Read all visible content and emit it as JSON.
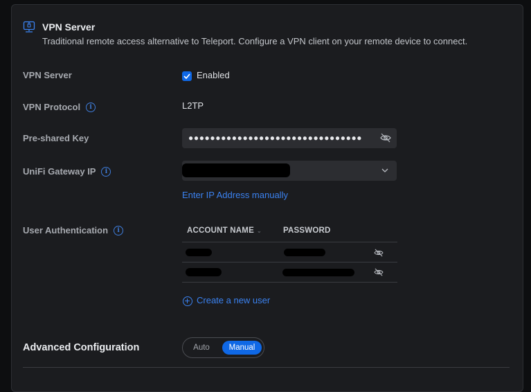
{
  "header": {
    "title": "VPN Server",
    "description": "Traditional remote access alternative to Teleport. Configure a VPN client on your remote device to connect."
  },
  "vpn_server": {
    "label": "VPN Server",
    "checkbox_label": "Enabled",
    "checked": true
  },
  "vpn_protocol": {
    "label": "VPN Protocol",
    "value": "L2TP"
  },
  "preshared_key": {
    "label": "Pre-shared Key",
    "masked_value": "●●●●●●●●●●●●●●●●●●●●●●●●●●●●●●●●"
  },
  "gateway_ip": {
    "label": "UniFi Gateway IP",
    "manual_link": "Enter IP Address manually"
  },
  "user_auth": {
    "label": "User Authentication",
    "columns": [
      "ACCOUNT NAME",
      "PASSWORD"
    ],
    "create_user": "Create a new user"
  },
  "advanced": {
    "title": "Advanced Configuration",
    "options": [
      "Auto",
      "Manual"
    ],
    "selected": "Manual"
  },
  "colors": {
    "accent": "#0f68e6",
    "link": "#3b82f0",
    "panel": "#1b1c1f",
    "field": "#2c2d31"
  }
}
